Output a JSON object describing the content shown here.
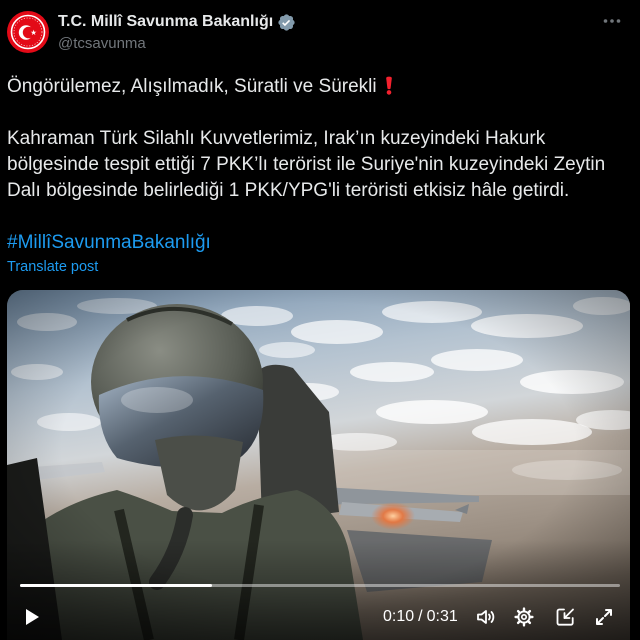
{
  "post": {
    "author": {
      "display_name": "T.C. Millî Savunma Bakanlığı",
      "handle": "@tcsavunma",
      "avatar_icon": "turkish-defense-ministry-seal-icon",
      "verified_icon": "verified-badge-icon"
    },
    "more_icon": "more-options-icon",
    "text": {
      "headline": "Öngörülemez, Alışılmadık, Süratli ve Sürekli",
      "headline_emoji_icon": "heavy-exclamation-mark-icon",
      "body_lines": [
        "Kahraman Türk Silahlı Kuvvetlerimiz, Irak’ın kuzeyindeki Hakurk",
        "bölgesinde tespit ettiği 7 PKK’lı terörist ile Suriye'nin kuzeyindeki Zeytin",
        "Dalı bölgesinde belirlediği 1 PKK/YPG'li teröristi etkisiz hâle getirdi."
      ],
      "hashtag": "#MillîSavunmaBakanlığı"
    },
    "translate_label": "Translate post"
  },
  "video": {
    "time_current": "0:10",
    "time_separator": "/",
    "time_total": "0:31",
    "progress": 0.32,
    "controls": {
      "play_icon": "play-icon",
      "volume_icon": "volume-icon",
      "settings_icon": "settings-gear-icon",
      "pip_icon": "picture-in-picture-icon",
      "fullscreen_icon": "fullscreen-icon"
    }
  },
  "colors": {
    "background": "#000000",
    "text": "#e7e9ea",
    "secondary_text": "#71767b",
    "link": "#1d9bf0",
    "verified_badge": "#829aab",
    "emoji_red": "#f4212e",
    "avatar_red": "#e30a17"
  }
}
